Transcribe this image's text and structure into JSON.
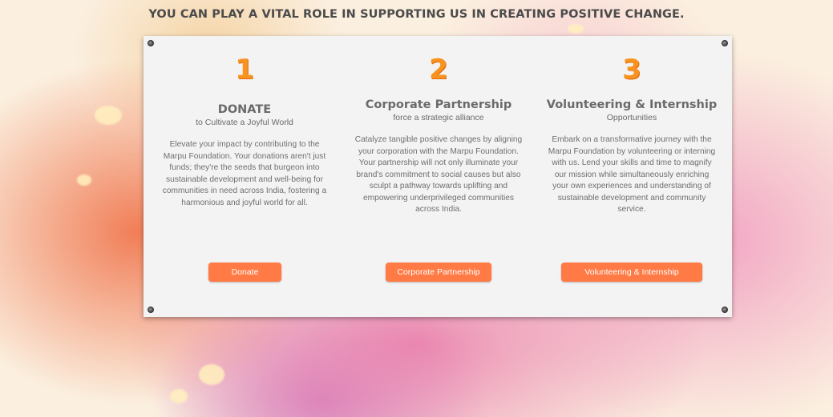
{
  "headline": "YOU CAN PLAY A VITAL ROLE IN SUPPORTING US IN CREATING POSITIVE CHANGE.",
  "accent_color": "#ff7a45",
  "number_color": "#f7931e",
  "cards": [
    {
      "number": "1",
      "title": "DONATE",
      "subtitle": "to Cultivate a Joyful World",
      "description": "Elevate your impact by contributing to the Marpu Foundation. Your donations aren't just funds; they're the seeds that burgeon into sustainable development and well-being for communities in need across India, fostering a harmonious and joyful world for all.",
      "button_label": "Donate"
    },
    {
      "number": "2",
      "title": "Corporate Partnership",
      "subtitle": "force a strategic alliance",
      "description": "Catalyze tangible positive changes by aligning your corporation with the Marpu Foundation. Your partnership will not only illuminate your brand's commitment to social causes but also sculpt a pathway towards uplifting and empowering underprivileged communities across India.",
      "button_label": "Corporate Partnership"
    },
    {
      "number": "3",
      "title": "Volunteering & Internship",
      "subtitle": "Opportunities",
      "description": "Embark on a transformative journey with the Marpu Foundation by volunteering or interning with us. Lend your skills and time to magnify our mission while simultaneously enriching your own experiences and understanding of sustainable development and community service.",
      "button_label": "Volunteering & Internship"
    }
  ]
}
